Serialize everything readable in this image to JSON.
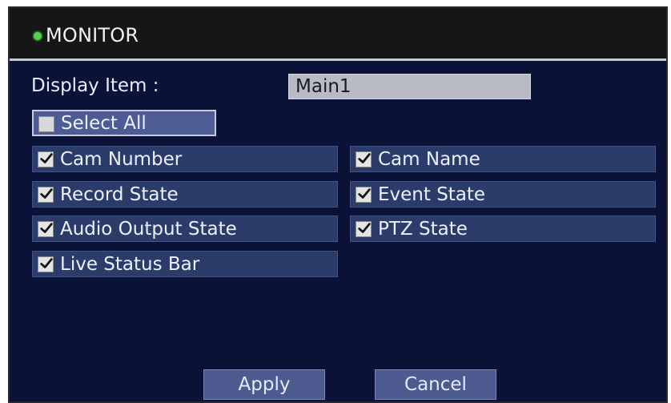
{
  "window": {
    "title": "MONITOR",
    "status_color": "#4fd24a"
  },
  "display_item": {
    "label": "Display Item :",
    "value": "Main1"
  },
  "select_all": {
    "label": "Select All",
    "checked": false
  },
  "options": [
    {
      "label": "Cam Number",
      "checked": true
    },
    {
      "label": "Cam Name",
      "checked": true
    },
    {
      "label": "Record State",
      "checked": true
    },
    {
      "label": "Event State",
      "checked": true
    },
    {
      "label": "Audio Output State",
      "checked": true
    },
    {
      "label": "PTZ State",
      "checked": true
    },
    {
      "label": "Live Status Bar",
      "checked": true
    }
  ],
  "buttons": {
    "apply": "Apply",
    "cancel": "Cancel"
  },
  "colors": {
    "background": "#0b1237",
    "titlebar": "#161616",
    "option_fill": "#2b3b6a",
    "button_fill": "#4d5a8f"
  }
}
